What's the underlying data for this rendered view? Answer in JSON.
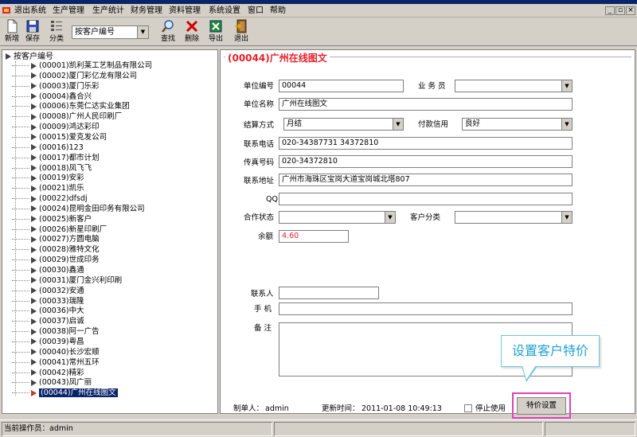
{
  "menu": {
    "items": [
      "退出系统",
      "生产管理",
      "生产统计",
      "财务管理",
      "资料管理",
      "系统设置",
      "窗口",
      "帮助"
    ]
  },
  "toolbar": {
    "new_label": "新增",
    "save_label": "保存",
    "category_label": "分类",
    "sort_value": "按客户编号",
    "search_label": "查找",
    "delete_label": "删除",
    "export_label": "导出",
    "exit_label": "退出"
  },
  "tree": {
    "root_label": "按客户编号",
    "items": [
      "(00001)凯利莱工艺制品有限公司",
      "(00002)厦门彩亿龙有限公司",
      "(00003)厦门乐彩",
      "(00004)鑫合兴",
      "(00006)东莞仁达实业集团",
      "(00008)广州人民印刷厂",
      "(00009)鸿达彩印",
      "(00015)爱克发公司",
      "(00016)123",
      "(00017)都市计划",
      "(00018)凤飞飞",
      "(00019)安彩",
      "(00021)凯乐",
      "(00022)dfsdj",
      "(00024)昆明金田印务有限公司",
      "(00025)新客户",
      "(00026)新星印刷厂",
      "(00027)方圆电脑",
      "(00028)雅特文化",
      "(00029)世成印务",
      "(00030)鑫通",
      "(00031)厦门金兴利印刷",
      "(00032)安通",
      "(00033)瑞隆",
      "(00036)中大",
      "(00037)启诚",
      "(00038)阿一广告",
      "(00039)粤昌",
      "(00040)长沙宏顺",
      "(00041)常州五环",
      "(00042)精彩",
      "(00043)凤广丽",
      "(00044)广州在线图文"
    ]
  },
  "form": {
    "title": "(00044)广州在线图文",
    "unit_code_label": "单位编号",
    "unit_code": "00044",
    "salesman_label": "业 务 员",
    "salesman": "",
    "unit_name_label": "单位名称",
    "unit_name": "广州在线图文",
    "settle_label": "结算方式",
    "settle": "月结",
    "credit_label": "付款信用",
    "credit": "良好",
    "phone_label": "联系电话",
    "phone": "020-34387731 34372810",
    "fax_label": "传真号码",
    "fax": "020-34372810",
    "address_label": "联系地址",
    "address": "广州市海珠区宝岗大道宝岗城北塔807",
    "qq_label": "QQ",
    "qq": "",
    "coop_label": "合作状态",
    "coop": "",
    "category_label": "客户分类",
    "category": "",
    "balance_label": "余额",
    "balance": "4.60",
    "contact_label": "联系人",
    "contact": "",
    "mobile_label": "手 机",
    "mobile": "",
    "remark_label": "备 注",
    "creator_label": "制单人：",
    "creator": "admin",
    "update_label": "更新时间：",
    "update_time": "2011-01-08 10:49:13",
    "disable_label": "停止使用",
    "price_button": "特价设置",
    "callout": "设置客户特价"
  },
  "status": {
    "operator_label": "当前操作员：",
    "operator": "admin"
  },
  "colors": {
    "accent_red": "#e8202a",
    "highlight_magenta": "#e040c0",
    "callout_blue": "#20a0d0",
    "selection": "#0a246a"
  }
}
